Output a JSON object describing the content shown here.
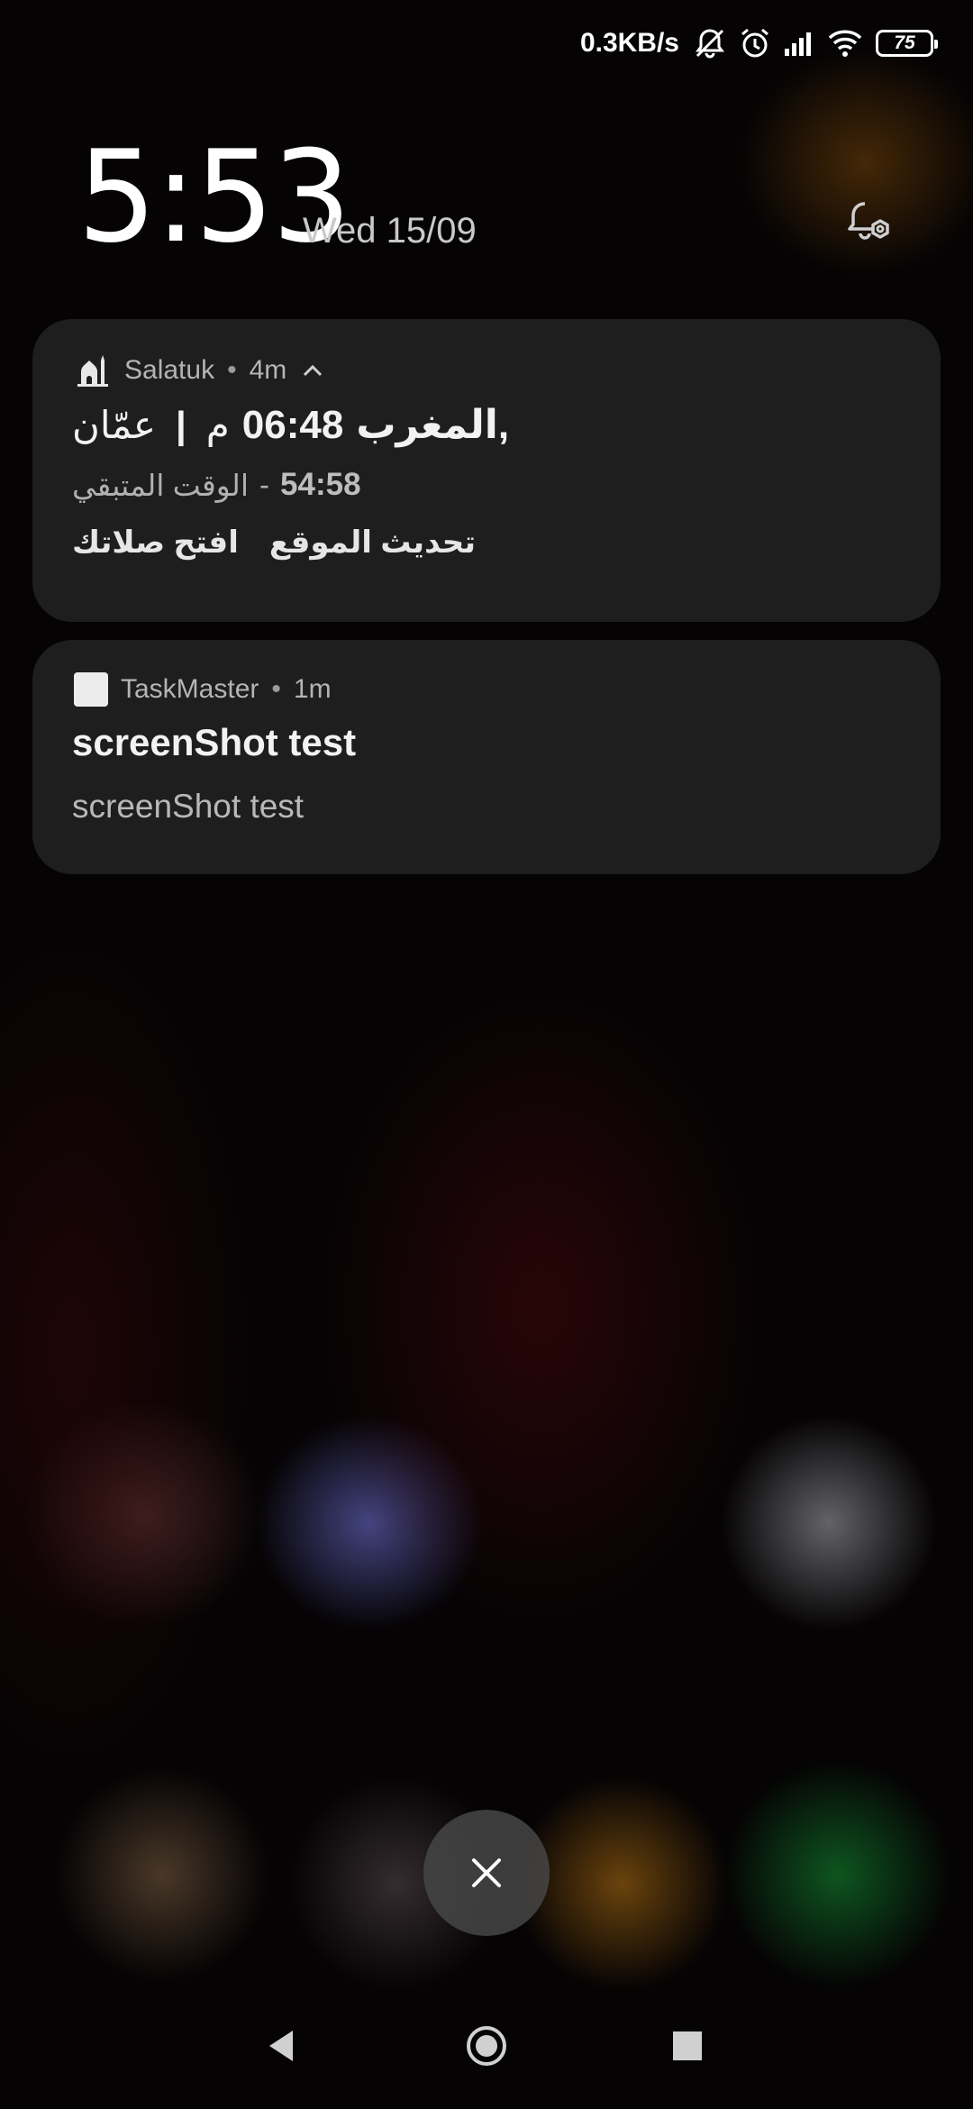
{
  "status_bar": {
    "net_speed": "0.3KB/s",
    "battery_level": "75",
    "icons": [
      "mute-icon",
      "alarm-icon",
      "signal-icon",
      "wifi-icon",
      "battery-icon"
    ]
  },
  "lockscreen": {
    "time": "5:53",
    "date": "Wed 15/09"
  },
  "notifications": [
    {
      "app": "Salatuk",
      "age": "4m",
      "icon": "mosque-icon",
      "prayer_name": "المغرب,",
      "prayer_time": "06:48",
      "prayer_suffix": "م",
      "separator": "|",
      "city": "عمّان",
      "remaining_label": "الوقت المتبقي",
      "remaining_dash": "-",
      "remaining_time": "54:58",
      "actions": [
        "افتح صلاتك",
        "تحديث الموقع"
      ]
    },
    {
      "app": "TaskMaster",
      "age": "1m",
      "icon": "app-square-icon",
      "title": "screenShot test",
      "body": "screenShot test"
    }
  ],
  "dot": "•",
  "colors": {
    "card_bg": "#1e1e1f",
    "text_primary": "#f2f2f2",
    "text_secondary": "#b4b4b4"
  }
}
